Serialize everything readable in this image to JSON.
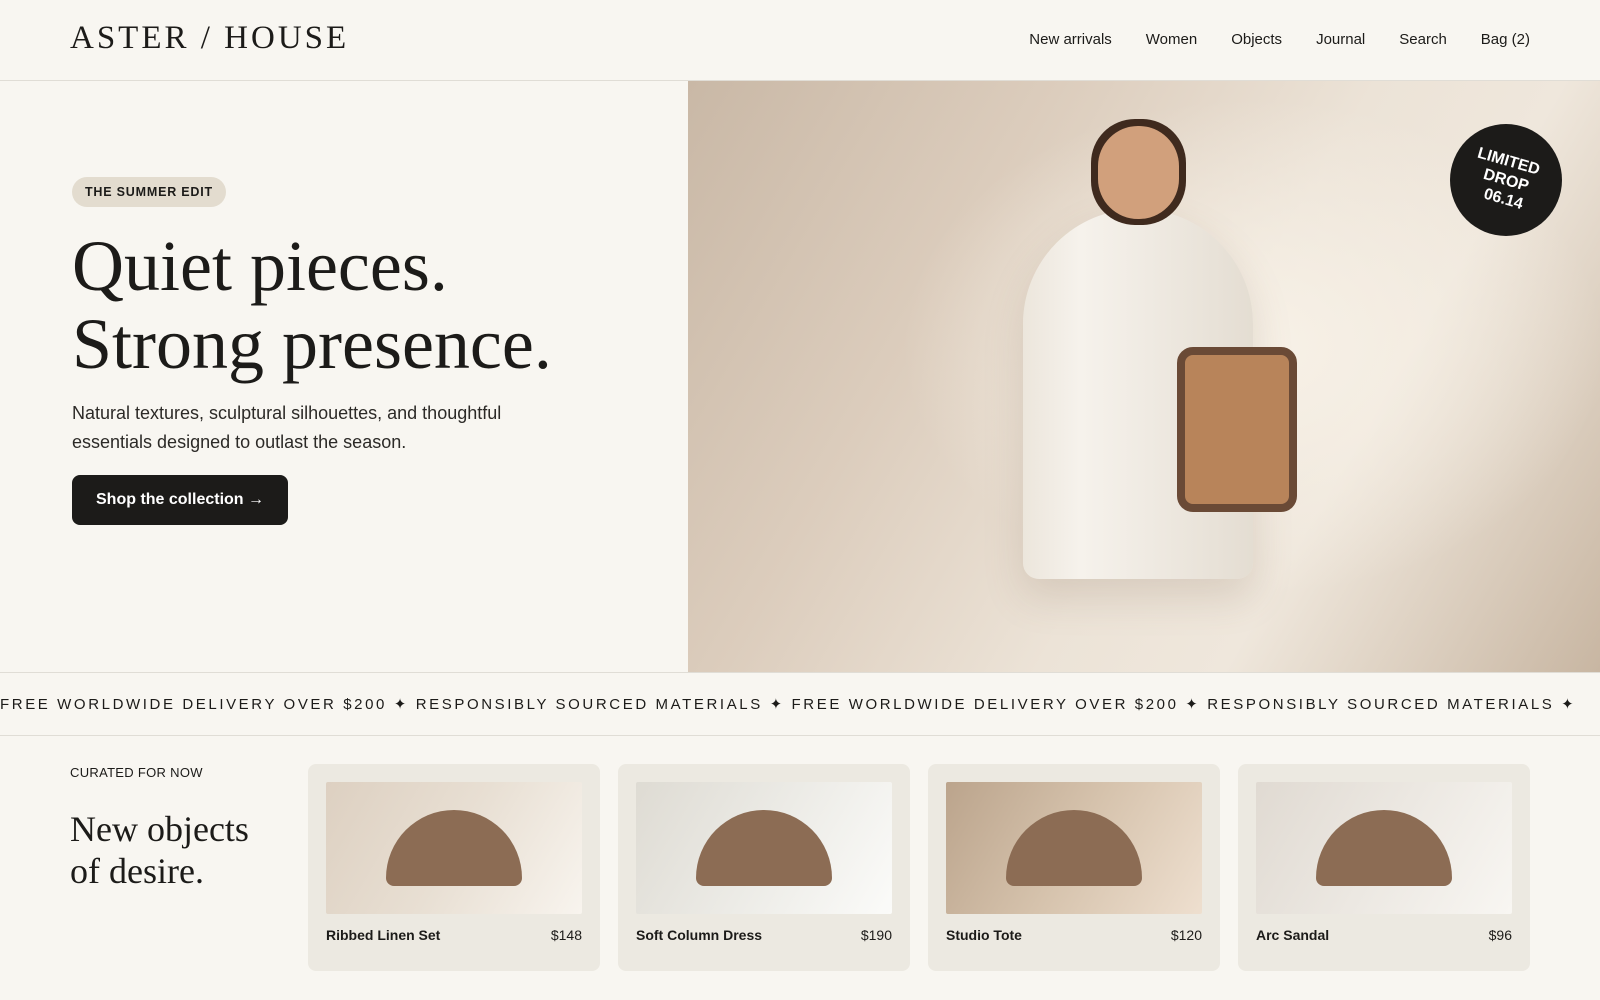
{
  "brand": {
    "logo": "ASTER / HOUSE"
  },
  "nav": {
    "items": [
      "New arrivals",
      "Women",
      "Objects",
      "Journal",
      "Search",
      "Bag (2)"
    ]
  },
  "hero": {
    "eyebrow": "THE SUMMER EDIT",
    "headline_line1": "Quiet pieces.",
    "headline_line2": "Strong presence.",
    "subtext": "Natural textures, sculptural silhouettes, and thoughtful essentials designed to outlast the season.",
    "cta_label": "Shop the collection →",
    "badge": {
      "line1": "LIMITED",
      "line2": "DROP",
      "line3": "06.14"
    }
  },
  "marquee": {
    "text": "FREE WORLDWIDE DELIVERY OVER $200 ✦ RESPONSIBLY SOURCED MATERIALS ✦ FREE WORLDWIDE DELIVERY OVER $200 ✦ RESPONSIBLY SOURCED MATERIALS ✦"
  },
  "curated": {
    "eyebrow": "CURATED FOR NOW",
    "title_line1": "New objects",
    "title_line2": "of desire.",
    "products": [
      {
        "name": "Ribbed Linen Set",
        "price": "$148"
      },
      {
        "name": "Soft Column Dress",
        "price": "$190"
      },
      {
        "name": "Studio Tote",
        "price": "$120"
      },
      {
        "name": "Arc Sandal",
        "price": "$96"
      }
    ]
  },
  "colors": {
    "background": "#f8f6f1",
    "ink": "#1c1b19",
    "pill": "#e3dccf",
    "card": "#ece9e1",
    "product_shape": "#8c6c54",
    "bag": "#b8845a"
  }
}
